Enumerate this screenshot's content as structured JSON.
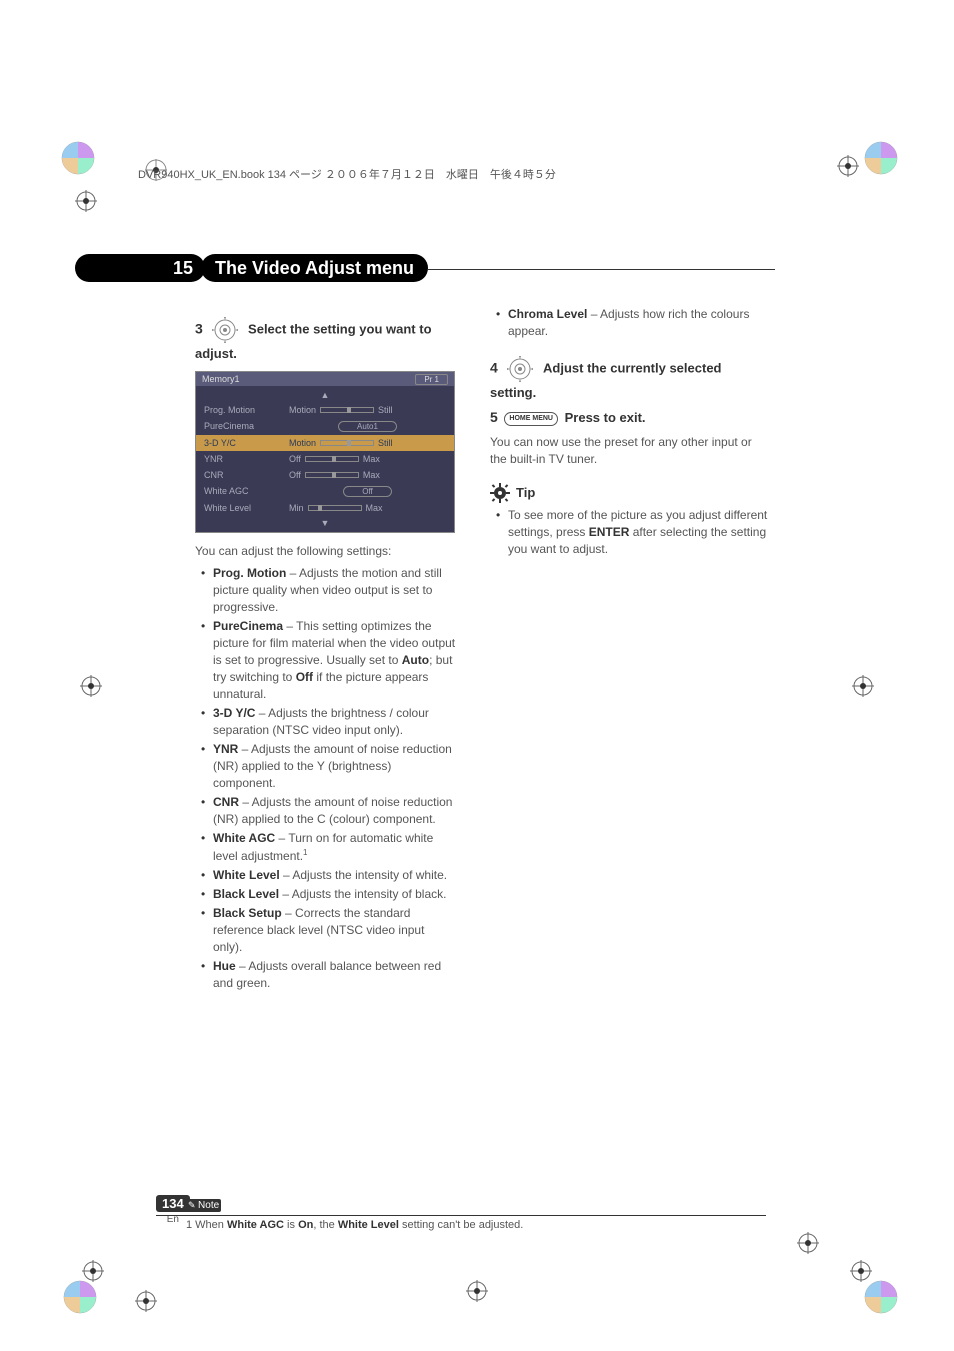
{
  "header_line": "DVR940HX_UK_EN.book  134 ページ  ２００６年７月１２日　水曜日　午後４時５分",
  "section": {
    "number": "15",
    "title": "The Video Adjust menu"
  },
  "left": {
    "step_num": "3",
    "step_text": "Select the setting you want to adjust.",
    "osd": {
      "title": "Memory1",
      "pr_label": "Pr 1",
      "rows": [
        {
          "label": "Prog. Motion",
          "type": "slider",
          "left": "Motion",
          "right": "Still",
          "knob": 50
        },
        {
          "label": "PureCinema",
          "type": "pill",
          "value": "Auto1"
        },
        {
          "label": "3-D  Y/C",
          "type": "slider",
          "left": "Motion",
          "right": "Still",
          "knob": 50,
          "sel": true
        },
        {
          "label": "YNR",
          "type": "slider",
          "left": "Off",
          "right": "Max",
          "knob": 50
        },
        {
          "label": "CNR",
          "type": "slider",
          "left": "Off",
          "right": "Max",
          "knob": 50
        },
        {
          "label": "White  AGC",
          "type": "pill",
          "value": "Off"
        },
        {
          "label": "White  Level",
          "type": "slider",
          "left": "Min",
          "right": "Max",
          "knob": 18
        }
      ]
    },
    "intro": "You can adjust the following settings:",
    "settings": [
      {
        "name": "Prog. Motion",
        "desc": " – Adjusts the motion and still picture quality when video output is set to progressive."
      },
      {
        "name": "PureCinema",
        "desc": " – This setting optimizes the picture for film material when the video output is set to progressive. Usually set to ",
        "b1": "Auto",
        "desc2": "; but try switching to ",
        "b2": "Off",
        "desc3": " if the picture appears unnatural."
      },
      {
        "name": "3-D Y/C",
        "desc": " – Adjusts the brightness / colour separation (NTSC video input only)."
      },
      {
        "name": "YNR",
        "desc": " – Adjusts the amount of noise reduction (NR) applied to the Y (brightness) component."
      },
      {
        "name": "CNR",
        "desc": " – Adjusts the amount of noise reduction (NR) applied to the C (colour) component."
      },
      {
        "name": "White AGC",
        "desc": " – Turn on for automatic white level adjustment.",
        "sup": "1"
      },
      {
        "name": "White Level",
        "desc": " – Adjusts the intensity of white."
      },
      {
        "name": "Black Level",
        "desc": " – Adjusts the intensity of black."
      },
      {
        "name": "Black Setup",
        "desc": " – Corrects the standard reference black level (NTSC video input only)."
      },
      {
        "name": "Hue",
        "desc": " – Adjusts overall balance between red and green."
      }
    ]
  },
  "right": {
    "chroma": {
      "name": "Chroma Level",
      "desc": " – Adjusts how rich the colours appear."
    },
    "step4_num": "4",
    "step4_text": "Adjust the currently selected setting.",
    "step5_num": "5",
    "step5_btn": "HOME MENU",
    "step5_text": "Press to exit.",
    "step5_body": "You can now use the preset for any other input or the built-in TV tuner.",
    "tip_label": "Tip",
    "tip_text_a": "To see more of the picture as you adjust different settings, press ",
    "tip_text_b": "ENTER",
    "tip_text_c": " after selecting the setting you want to adjust."
  },
  "note": {
    "label": "Note",
    "text_a": "1 When ",
    "b1": "White AGC",
    "text_b": " is ",
    "b2": "On",
    "text_c": ", the ",
    "b3": "White Level",
    "text_d": " setting can't be adjusted."
  },
  "page": {
    "num": "134",
    "lang": "En"
  }
}
